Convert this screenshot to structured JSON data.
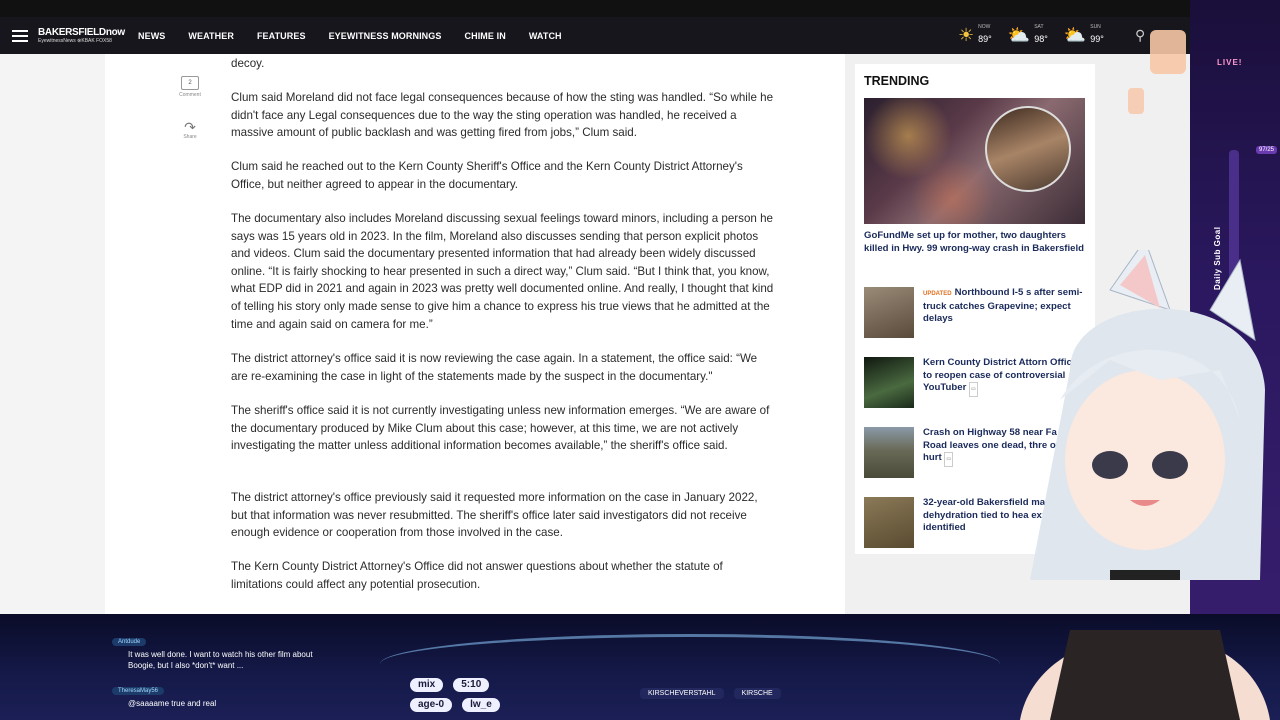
{
  "nav": {
    "logo_line1": "BAKERSFIELDnow",
    "logo_line2": "EyewitnessNews ⊗KBAK FOX58",
    "links": [
      "NEWS",
      "WEATHER",
      "FEATURES",
      "EYEWITNESS MORNINGS",
      "CHIME IN",
      "WATCH"
    ],
    "weather": [
      {
        "day": "NOW",
        "temp": "89°",
        "icon": "sun-icon"
      },
      {
        "day": "SAT",
        "temp": "98°",
        "icon": "partly-cloudy-icon"
      },
      {
        "day": "SUN",
        "temp": "99°",
        "icon": "partly-cloudy-icon"
      }
    ]
  },
  "social": {
    "comment_count": "2",
    "comment_label": "Comment",
    "share_label": "Share"
  },
  "article": {
    "paragraphs": [
      "decoy.",
      "Clum said Moreland did not face legal consequences because of how the sting was handled. “So while he didn't face any Legal consequences due to the way the sting operation was handled, he received a massive amount of public backlash and was getting fired from jobs,” Clum said.",
      "Clum said he reached out to the Kern County Sheriff's Office and the Kern County District Attorney's Office, but neither agreed to appear in the documentary.",
      "The documentary also includes Moreland discussing sexual feelings toward minors, including a person he says was 15 years old in 2023. In the film, Moreland also discusses sending that person explicit photos and videos. Clum said the documentary presented information that had already been widely discussed online. “It is fairly shocking to hear presented in such a direct way,” Clum said. “But I think that, you know, what EDP did in 2021 and again in 2023 was pretty well documented online. And really, I thought that kind of telling his story only made sense to give him a chance to express his true views that he admitted at the time and again said on camera for me.”",
      "The district attorney's office said it is now reviewing the case again. In a statement, the office said: “We are re-examining the case in light of the statements made by the suspect in the documentary.\"",
      "The sheriff's office said it is not currently investigating unless new information emerges. “We are aware of the documentary produced by Mike Clum about this case; however, at this time, we are not actively investigating the matter unless additional information becomes available,” the sheriff's office said.",
      "The district attorney's office previously said it requested more information on the case in January 2022, but that information was never resubmitted. The sheriff's office later said investigators did not receive enough evidence or cooperation from those involved in the case.",
      "The Kern County District Attorney's Office did not answer questions about whether the statute of limitations could affect any potential prosecution."
    ]
  },
  "trending": {
    "title": "TRENDING",
    "hero_caption": "GoFundMe set up for mother, two daughters killed in Hwy. 99 wrong-way crash in Bakersfield",
    "items": [
      {
        "badge": "UPDATED",
        "title": "Northbound I-5 s after semi-truck catches Grapevine; expect delays",
        "thumb": "#7a6a5a"
      },
      {
        "badge": "",
        "title": "Kern County District Attorn Office to reopen case of controversial YouTuber",
        "thumb": "#2a3a2a"
      },
      {
        "badge": "",
        "title": "Crash on Highway 58 near Fa Road leaves one dead, thre others hurt",
        "thumb": "#6a6a58"
      },
      {
        "badge": "",
        "title": "32-year-old Bakersfield man of dehydration tied to hea exposure identified",
        "thumb": "#7a6a48"
      }
    ]
  },
  "stream": {
    "live_label": "LIVE!",
    "goal_label": "Daily Sub Goal",
    "goal_count": "97/25",
    "chat": [
      {
        "user": "Antdude",
        "text": "It was well done. I want to watch his other film about Boogie, but I also *don't* want ..."
      },
      {
        "user": "TheresaMay56",
        "text": "@saaaame true and real"
      }
    ],
    "pills": [
      "mix",
      "5:10",
      "age-0",
      "lw_e"
    ],
    "handles": [
      "KIRSCHEVERSTAHL",
      "KIRSCHE"
    ]
  },
  "colors": {
    "nav_bg": "#16161c",
    "headline": "#1a2a5a",
    "updated": "#e07020"
  }
}
